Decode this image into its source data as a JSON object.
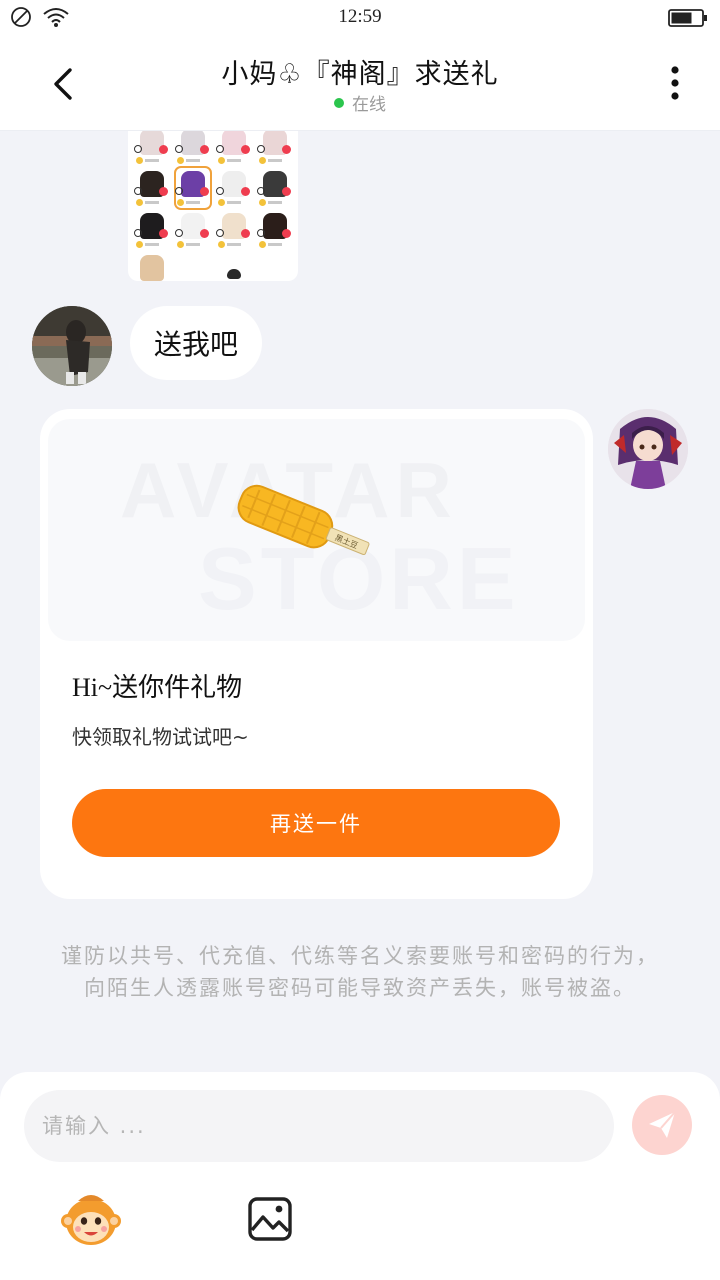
{
  "status_bar": {
    "time": "12:59",
    "icons": [
      "do-not-disturb-icon",
      "wifi-icon",
      "battery-icon"
    ]
  },
  "header": {
    "title": "小妈♧『神阁』求送礼",
    "status": "在线",
    "status_color": "#2bc54d",
    "back_icon": "chevron-left-icon",
    "more_icon": "more-vertical-icon"
  },
  "messages": [
    {
      "side": "left",
      "type": "image",
      "content": "gift-list-screenshot"
    },
    {
      "side": "left",
      "type": "text",
      "text": "送我吧"
    },
    {
      "side": "right",
      "type": "gift-card",
      "watermark": [
        "AVATAR",
        "STORE"
      ],
      "gift_label": "黑土豆",
      "title_prefix": "Hi~",
      "title": "送你件礼物",
      "subtitle": "快领取礼物试试吧~",
      "button_label": "再送一件",
      "button_color": "#fd7610"
    }
  ],
  "warning": "谨防以共号、代充值、代练等名义索要账号和密码的行为，向陌生人透露账号密码可能导致资产丢失，账号被盗。",
  "input": {
    "placeholder": "请输入 ...",
    "value": "",
    "send_icon": "send-icon",
    "send_color": "#fdd4d0"
  },
  "toolbar": {
    "items": [
      {
        "icon": "emoji-monkey-icon"
      },
      {
        "icon": "image-icon"
      }
    ]
  },
  "colors": {
    "background": "#f2f3f8",
    "accent": "#fd7610"
  }
}
